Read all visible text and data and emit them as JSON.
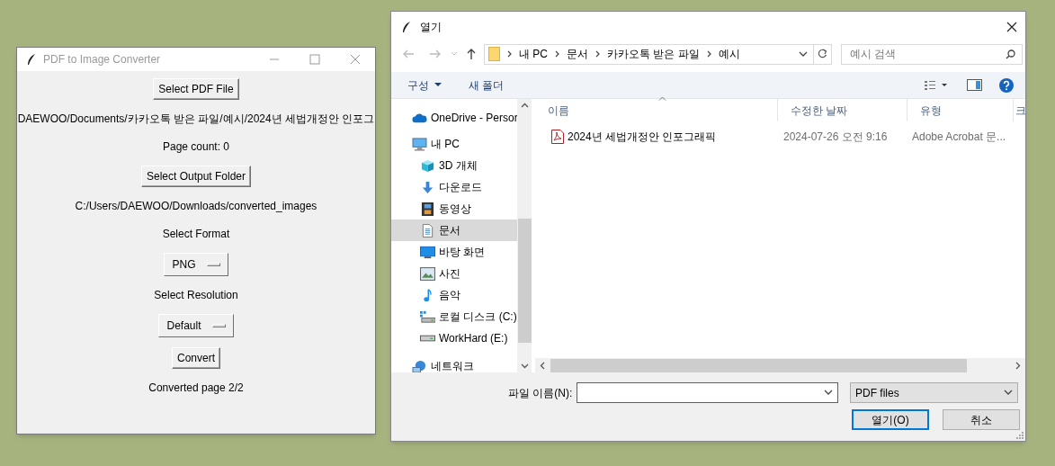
{
  "converter": {
    "title": "PDF to Image Converter",
    "items": [
      {
        "kind": "button",
        "text": "Select PDF File"
      },
      {
        "kind": "label",
        "text": "DAEWOO/Documents/카카오톡 받은 파일/예시/2024년 세법개정안 인포그"
      },
      {
        "kind": "label",
        "text": "Page count: 0"
      },
      {
        "kind": "button",
        "text": "Select Output Folder"
      },
      {
        "kind": "label",
        "text": "C:/Users/DAEWOO/Downloads/converted_images"
      },
      {
        "kind": "label",
        "text": "Select Format"
      },
      {
        "kind": "menu",
        "text": "PNG"
      },
      {
        "kind": "label",
        "text": "Select Resolution"
      },
      {
        "kind": "menu",
        "text": "Default"
      },
      {
        "kind": "button",
        "text": "Convert"
      },
      {
        "kind": "label",
        "text": "Converted page 2/2"
      }
    ]
  },
  "dialog": {
    "title": "열기",
    "breadcrumb": [
      "내 PC",
      "문서",
      "카카오톡 받은 파일",
      "예시"
    ],
    "search": {
      "placeholder": "예시 검색"
    },
    "toolbar": [
      {
        "text": "구성",
        "dropdown": true
      },
      {
        "text": "새 폴더",
        "dropdown": false
      }
    ],
    "nav": [
      {
        "kind": "cloud",
        "label": "OneDrive - Persor",
        "selected": false
      },
      {
        "kind": "computer",
        "label": "내 PC",
        "selected": false,
        "children": [
          {
            "kind": "cube",
            "label": "3D 개체",
            "selected": false
          },
          {
            "kind": "download",
            "label": "다운로드",
            "selected": false
          },
          {
            "kind": "film",
            "label": "동영상",
            "selected": false
          },
          {
            "kind": "document",
            "label": "문서",
            "selected": true
          },
          {
            "kind": "desktop",
            "label": "바탕 화면",
            "selected": false
          },
          {
            "kind": "photo",
            "label": "사진",
            "selected": false
          },
          {
            "kind": "music",
            "label": "음악",
            "selected": false
          },
          {
            "kind": "disk",
            "label": "로컬 디스크 (C:)",
            "selected": false
          },
          {
            "kind": "drive",
            "label": "WorkHard (E:)",
            "selected": false
          }
        ]
      },
      {
        "kind": "network",
        "label": "네트워크",
        "selected": false
      }
    ],
    "columns": [
      "이름",
      "수정한 날짜",
      "유형",
      "크"
    ],
    "files": [
      {
        "name": "2024년 세법개정안 인포그래픽",
        "modified": "2024-07-26 오전 9:16",
        "type": "Adobe Acrobat 문...",
        "selected": false
      }
    ],
    "filename_label": "파일 이름(N):",
    "file_type": "PDF files",
    "buttons": [
      {
        "text": "열기(O)",
        "default": true
      },
      {
        "text": "취소",
        "default": false
      }
    ]
  }
}
